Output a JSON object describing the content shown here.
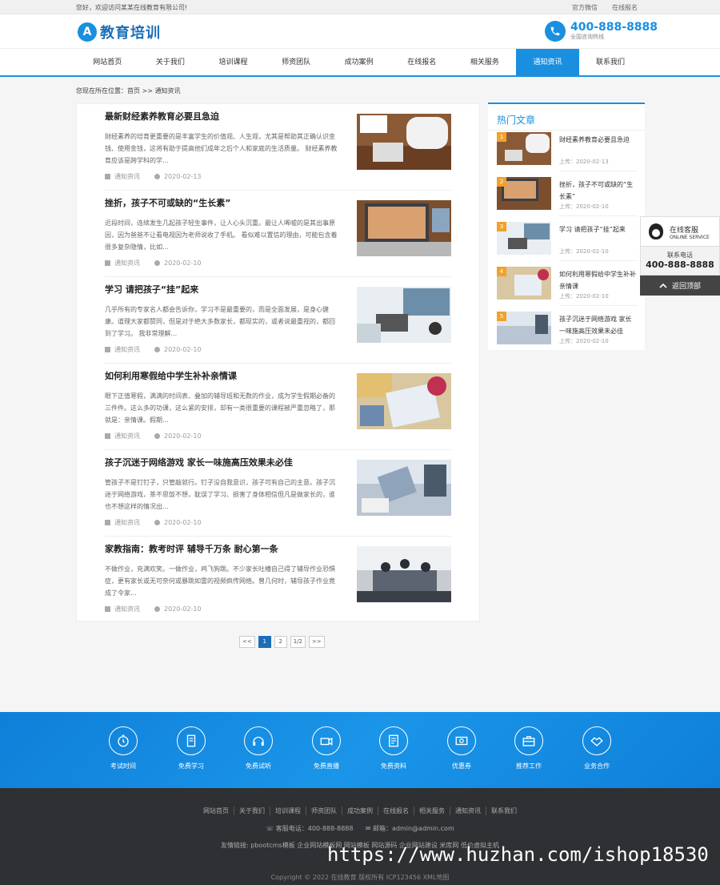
{
  "topbar": {
    "welcome": "您好，欢迎访问某某在线教育有限公司!",
    "links": [
      "官方微信",
      "在线报名"
    ]
  },
  "header": {
    "logo_letter": "A",
    "logo_text": "教育培训",
    "hotline": "400-888-8888",
    "hotline_sub": "全国咨询热线"
  },
  "nav": {
    "items": [
      "网站首页",
      "关于我们",
      "培训课程",
      "师资团队",
      "成功案例",
      "在线报名",
      "相关服务",
      "通知资讯",
      "联系我们"
    ],
    "active_index": 7
  },
  "breadcrumb": "您现在所在位置：首页 >> 通知资讯",
  "articles": [
    {
      "title": "最新财经素养教育必要且急迫",
      "summary": "财经素养的培育更重要的是丰富学生的价值观、人生观，尤其是帮助其正确认识金钱、使用金钱，这将有助于提高他们成年之后个人和家庭的生活质量。 财经素养教育应该是跨学科的学...",
      "category": "通知资讯",
      "date": "2020-02-13"
    },
    {
      "title": "挫折，孩子不可或缺的“生长素”",
      "summary": "近段时间，连续发生几起孩子轻生事件，让人心头沉重。最让人唏嘘的是其出事原因，因为爸爸不让看电视因为老师说收了手机。 看似难以置信的理由，可能包含着很多复杂隐情，比如...",
      "category": "通知资讯",
      "date": "2020-02-10"
    },
    {
      "title": "学习 请把孩子“挂”起来",
      "summary": "几乎所有的专家名人都会告诉你，学习不是最重要的，而是全面发展，是身心健康。道理大家都赞同，但是对于绝大多数家长，都现实的，或者说最重视的，都回到了学习。 我非常理解...",
      "category": "通知资讯",
      "date": "2020-02-10"
    },
    {
      "title": "如何利用寒假给中学生补补亲情课",
      "summary": "眼下正值寒假，满满的时间表、叠加的辅导班和无数的作业，成为学生假期必备的三件件。这么多的功课，这么紧的安排，却有一类很重要的课程被严重忽略了，那就是：亲情课。假期...",
      "category": "通知资讯",
      "date": "2020-02-10"
    },
    {
      "title": "孩子沉迷于网络游戏 家长一味施高压效果未必佳",
      "summary": "管孩子不是钉钉子，只管敲就行。钉子没自我意识，孩子可有自己的主意。孩子沉迷于网络游戏，茶不思饭不想，耽误了学习、损害了身体相信但凡是做家长的，谁也不想这样的情况出...",
      "category": "通知资讯",
      "date": "2020-02-10"
    },
    {
      "title": "家教指南：教考时评 辅导千万条 耐心第一条",
      "summary": "不做作业，充满欢笑。一做作业，鸡飞狗跳。不少家长吐槽自己得了辅导作业恐惧症，更有家长或无可奈何或暴跳如雷的视频疯传网络。曾几何时，辅导孩子作业竟成了令家...",
      "category": "通知资讯",
      "date": "2020-02-10"
    }
  ],
  "pager": {
    "prev": "<<",
    "pages": [
      "1",
      "2"
    ],
    "current": "1",
    "info": "1/2",
    "next": ">>"
  },
  "sidebar": {
    "title": "热门文章",
    "items": [
      {
        "rank": "1",
        "title": "财经素养教育必要且急迫",
        "date": "上传：2020-02-13"
      },
      {
        "rank": "2",
        "title": "挫折，孩子不可或缺的“生长素”",
        "date": "上传：2020-02-10"
      },
      {
        "rank": "3",
        "title": "学习 请把孩子“挂”起来",
        "date": "上传：2020-02-10"
      },
      {
        "rank": "4",
        "title": "如何利用寒假给中学生补补亲情课",
        "date": "上传：2020-02-10"
      },
      {
        "rank": "5",
        "title": "孩子沉迷于网络游戏 家长一味施高压效果未必佳",
        "date": "上传：2020-02-10"
      }
    ]
  },
  "float": {
    "service": "在线客服",
    "service_en": "ONLINE SERVICE",
    "tel_label": "联系电话",
    "tel": "400-888-8888",
    "top": "返回顶部"
  },
  "band": {
    "items": [
      "考试时间",
      "免费学习",
      "免费试听",
      "免费直播",
      "免费资料",
      "优惠券",
      "推荐工作",
      "业务合作"
    ]
  },
  "footer": {
    "links": [
      "网站首页",
      "关于我们",
      "培训课程",
      "师资团队",
      "成功案例",
      "在线报名",
      "相关服务",
      "通知资讯",
      "联系我们"
    ],
    "contact": "客服电话：400-888-8888",
    "email": "邮箱：admin@admin.com",
    "friends": "友情链接: pbootcms模板 企业网站模板网 网站模板 网站源码 企业网站建设 米库网 低价虚拟主机",
    "copy": "Copyright © 2022 在线教育 版权所有 ICP123456 XML地图"
  },
  "watermark": "https://www.huzhan.com/ishop18530",
  "colors": {
    "accent": "#1a8fe0",
    "footer_bg": "#2f3033",
    "rank": "#f0a22a"
  }
}
